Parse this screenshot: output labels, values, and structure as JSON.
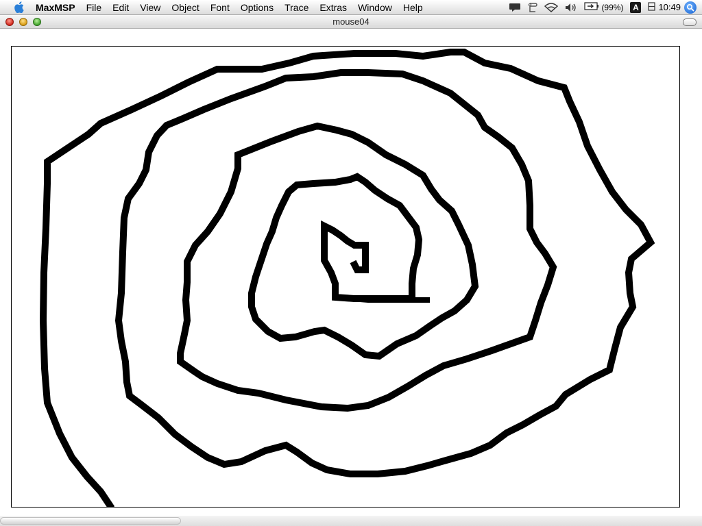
{
  "menubar": {
    "app_name": "MaxMSP",
    "items": [
      "File",
      "Edit",
      "View",
      "Object",
      "Font",
      "Options",
      "Trace",
      "Extras",
      "Window",
      "Help"
    ],
    "battery_label": "(99%)",
    "input_method": "A",
    "clock": "10:49"
  },
  "window": {
    "title": "mouse04"
  },
  "drawing": {
    "description_color": "#000000"
  }
}
